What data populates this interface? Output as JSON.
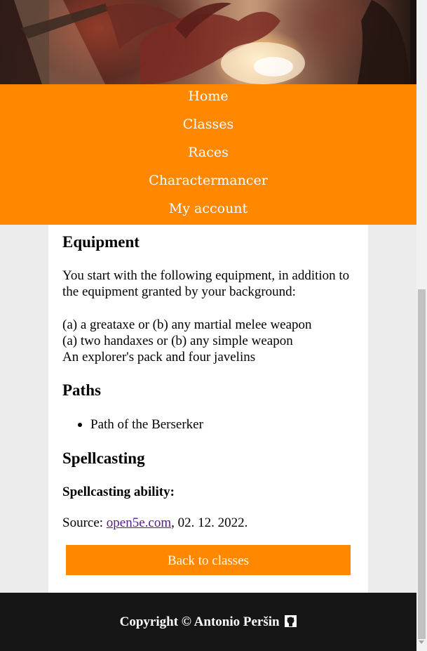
{
  "hero": {
    "image": "dragon-battle-banner"
  },
  "nav": {
    "items": [
      {
        "label": "Home"
      },
      {
        "label": "Classes"
      },
      {
        "label": "Races"
      },
      {
        "label": "Charactermancer"
      },
      {
        "label": "My account"
      }
    ]
  },
  "content": {
    "equipment_heading": "Equipment",
    "equipment_intro": "You start with the following equipment, in addition to the equipment granted by your background:",
    "equipment_lines": [
      "(a) a greataxe or (b) any martial melee weapon",
      "(a) two handaxes or (b) any simple weapon",
      "An explorer's pack and four javelins"
    ],
    "paths_heading": "Paths",
    "paths": [
      "Path of the Berserker"
    ],
    "spellcasting_heading": "Spellcasting",
    "spellcasting_ability_label": "Spellcasting ability:",
    "source_prefix": "Source: ",
    "source_link": "open5e.com",
    "source_suffix": ", 02. 12. 2022.",
    "back_button": "Back to classes"
  },
  "footer": {
    "copyright": "Copyright © Antonio Peršin",
    "icon": "github-icon"
  },
  "colors": {
    "accent": "#ff8800",
    "footer_bg": "#161616",
    "page_bg": "#ececec",
    "link": "#551a8b"
  }
}
